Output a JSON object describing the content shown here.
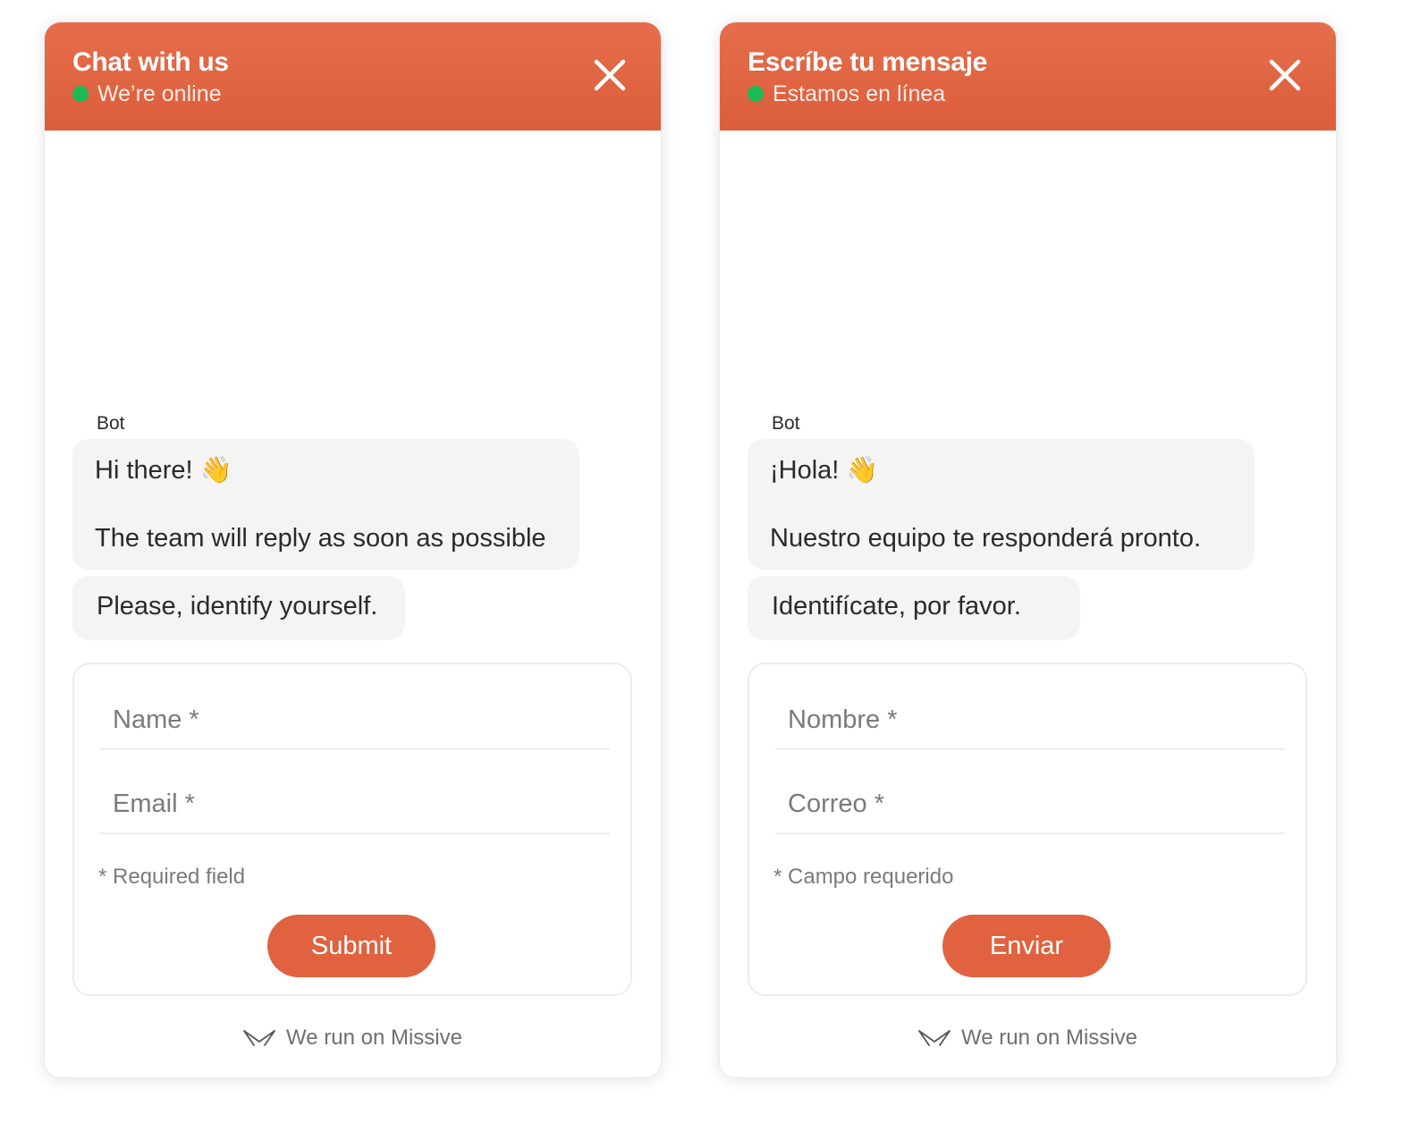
{
  "colors": {
    "header": "#e0623f",
    "online_dot": "#1db954",
    "button": "#e0623f",
    "bubble": "#f4f4f4"
  },
  "widgets": [
    {
      "title": "Chat with us",
      "status": "We’re online",
      "close_icon": "close-icon",
      "author": "Bot",
      "greeting": "Hi there! 👋",
      "message_line": "The team will reply as soon as possible",
      "prompt": "Please, identify yourself.",
      "name_placeholder": "Name *",
      "email_placeholder": "Email *",
      "required_note": "* Required field",
      "submit_label": "Submit",
      "footer_icon": "missive-logo-icon",
      "footer_text": "We run on Missive"
    },
    {
      "title": "Escríbe tu mensaje",
      "status": "Estamos en línea",
      "close_icon": "close-icon",
      "author": "Bot",
      "greeting": "¡Hola! 👋",
      "message_line": "Nuestro equipo te responderá pronto.",
      "prompt": "Identifícate, por favor.",
      "name_placeholder": "Nombre *",
      "email_placeholder": "Correo *",
      "required_note": "*  Campo requerido",
      "submit_label": "Enviar",
      "footer_icon": "missive-logo-icon",
      "footer_text": "We run on Missive"
    }
  ]
}
